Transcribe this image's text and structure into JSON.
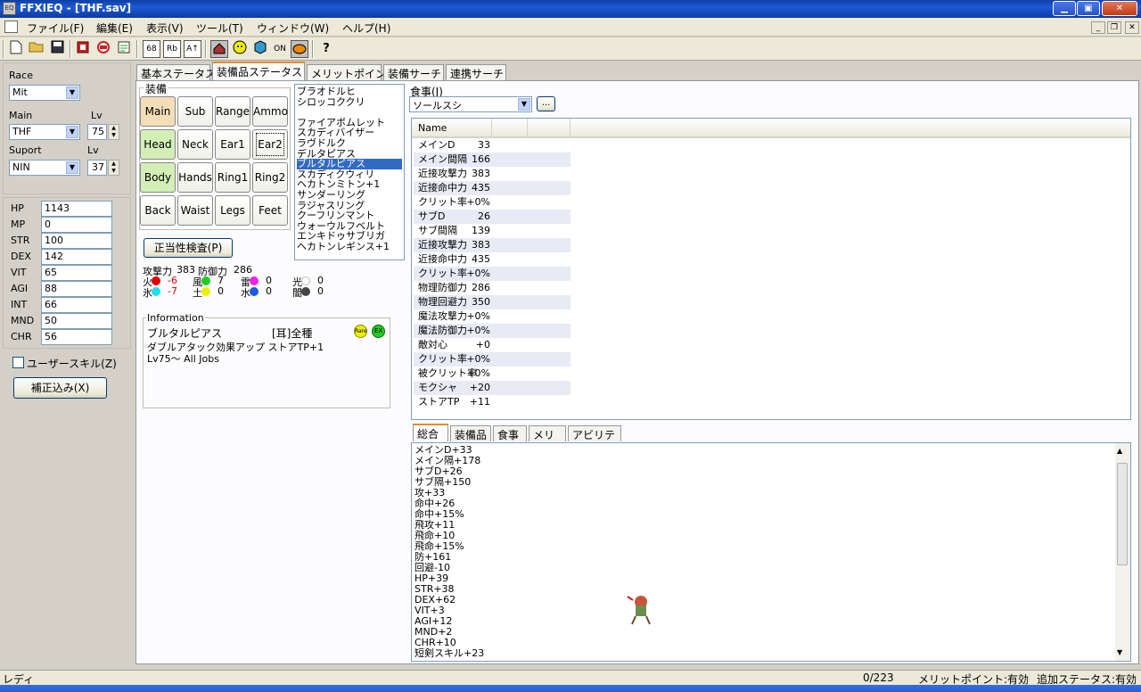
{
  "window": {
    "title": "FFXIEQ - [THF.sav]",
    "icon_text": "EQ",
    "min_glyph": "▁",
    "max_glyph": "▣",
    "close_glyph": "✕"
  },
  "menu": [
    "ファイル(F)",
    "編集(E)",
    "表示(V)",
    "ツール(T)",
    "ウィンドウ(W)",
    "ヘルプ(H)"
  ],
  "mdi": {
    "min": "_",
    "restore": "❐",
    "close": "✕"
  },
  "toolbar": {
    "t1": "68",
    "t2": "Rb",
    "t3": "A↑",
    "t4": "ON",
    "help": "?"
  },
  "left": {
    "race_label": "Race",
    "race_value": "Mit",
    "main_label": "Main",
    "main_value": "THF",
    "main_lv_label": "Lv",
    "main_lv": "75",
    "support_label": "Suport",
    "support_value": "NIN",
    "support_lv_label": "Lv",
    "support_lv": "37",
    "stats": [
      {
        "name": "HP",
        "value": "1143"
      },
      {
        "name": "MP",
        "value": "0"
      },
      {
        "name": "STR",
        "value": "100"
      },
      {
        "name": "DEX",
        "value": "142"
      },
      {
        "name": "VIT",
        "value": "65"
      },
      {
        "name": "AGI",
        "value": "88"
      },
      {
        "name": "INT",
        "value": "66"
      },
      {
        "name": "MND",
        "value": "50"
      },
      {
        "name": "CHR",
        "value": "56"
      }
    ],
    "user_skill_label": "ユーザースキル(Z)",
    "correct_button": "補正込み(X)"
  },
  "tabs": [
    "基本ステータス",
    "装備品ステータス",
    "メリットポイント",
    "装備サーチ",
    "連携サーチ"
  ],
  "equipment": {
    "group_label": "装備",
    "slots": [
      "Main",
      "Sub",
      "Range",
      "Ammo",
      "Head",
      "Neck",
      "Ear1",
      "Ear2",
      "Body",
      "Hands",
      "Ring1",
      "Ring2",
      "Back",
      "Waist",
      "Legs",
      "Feet"
    ],
    "items": [
      "ブラオドルヒ",
      "シロッコククリ",
      "",
      "ファイアボムレット",
      "スカディバイザー",
      "ラヴドルク",
      "デルタピアス",
      "ブルタルピアス",
      "スカディクウィリ",
      "ヘカトンミトン+1",
      "サンダーリング",
      "ラジャスリング",
      "クーフリンマント",
      "ウォーウルフベルト",
      "エンキドゥサブリガ",
      "ヘカトンレギンス+1"
    ],
    "check_button": "正当性検査(P)",
    "attack_label": "攻撃力",
    "attack_value": "383",
    "defense_label": "防御力",
    "defense_value": "286",
    "elements": [
      {
        "name": "火",
        "value": "-6",
        "color": "#e00000"
      },
      {
        "name": "風",
        "value": "7",
        "color": "#22cc22"
      },
      {
        "name": "雷",
        "value": "0",
        "color": "#ee22ee"
      },
      {
        "name": "光",
        "value": "0",
        "color": "#ffffff"
      },
      {
        "name": "氷",
        "value": "-7",
        "color": "#22ddee"
      },
      {
        "name": "土",
        "value": "0",
        "color": "#eeee00"
      },
      {
        "name": "水",
        "value": "0",
        "color": "#1a5ae6"
      },
      {
        "name": "闇",
        "value": "0",
        "color": "#444444"
      }
    ],
    "info_label": "Information",
    "info_name": "ブルタルピアス",
    "info_slot": "[耳]全種",
    "info_desc": "ダブルアタック効果アップ ストアTP+1",
    "info_jobs": "Lv75～ All Jobs",
    "info_badge1": "Rare",
    "info_badge2": "EX"
  },
  "food": {
    "label": "食事(J)",
    "value": "ソールスシ",
    "more_button": "..."
  },
  "status_list": {
    "header": "Name",
    "rows": [
      {
        "name": "メインD",
        "value": "33"
      },
      {
        "name": "メイン間隔",
        "value": "166"
      },
      {
        "name": "近接攻撃力",
        "value": "383"
      },
      {
        "name": "近接命中力",
        "value": "435"
      },
      {
        "name": "クリット率",
        "value": "+0%"
      },
      {
        "name": "サブD",
        "value": "26"
      },
      {
        "name": "サブ間隔",
        "value": "139"
      },
      {
        "name": "近接攻撃力",
        "value": "383"
      },
      {
        "name": "近接命中力",
        "value": "435"
      },
      {
        "name": "クリット率",
        "value": "+0%"
      },
      {
        "name": "物理防御力",
        "value": "286"
      },
      {
        "name": "物理回避力",
        "value": "350"
      },
      {
        "name": "魔法攻撃力",
        "value": "+0%"
      },
      {
        "name": "魔法防御力",
        "value": "+0%"
      },
      {
        "name": "敵対心",
        "value": "+0"
      },
      {
        "name": "クリット率",
        "value": "+0%"
      },
      {
        "name": "被クリット率",
        "value": "+0%"
      },
      {
        "name": "モクシャ",
        "value": "+20"
      },
      {
        "name": "ストアTP",
        "value": "+11"
      }
    ]
  },
  "bottom_tabs": [
    "総合",
    "装備品",
    "食事",
    "メリポ",
    "アビリティ"
  ],
  "bonus_lines": [
    "メインD+33",
    "メイン隔+178",
    "サブD+26",
    "サブ隔+150",
    "攻+33",
    "命中+26",
    "命中+15%",
    "飛攻+11",
    "飛命+10",
    "飛命+15%",
    "防+161",
    "回避-10",
    "HP+39",
    "STR+38",
    "DEX+62",
    "VIT+3",
    "AGI+12",
    "MND+2",
    "CHR+10",
    "短剣スキル+23"
  ],
  "statusbar": {
    "left": "レディ",
    "count": "0/223",
    "merit": "メリットポイント:有効",
    "extra": "追加ステータス:有効"
  }
}
